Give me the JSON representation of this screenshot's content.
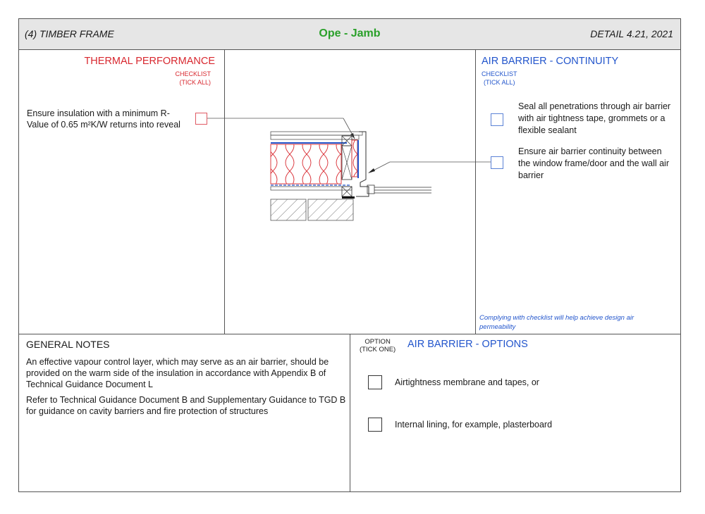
{
  "header": {
    "left": "(4) TIMBER FRAME",
    "center": "Ope - Jamb",
    "right": "DETAIL 4.21,  2021"
  },
  "thermal": {
    "title": "THERMAL PERFORMANCE",
    "checklist": "CHECKLIST",
    "tick": "(TICK ALL)",
    "item": "Ensure insulation with a minimum R-Value of 0.65 m²K/W returns into reveal"
  },
  "air_barrier": {
    "title": "AIR BARRIER - CONTINUITY",
    "checklist": "CHECKLIST",
    "tick": "(TICK ALL)",
    "items": [
      "Seal all penetrations through air barrier with air tightness tape, grommets or a flexible sealant",
      "Ensure air barrier continuity between the window frame/door and the wall air barrier"
    ],
    "note": "Complying with checklist will help achieve design air permeability"
  },
  "general_notes": {
    "title": "GENERAL NOTES",
    "paragraphs": [
      "An effective vapour control layer, which may serve as an air barrier, should be provided on the warm side of the insulation in accordance with Appendix B of Technical Guidance Document L",
      "Refer to Technical Guidance Document B and Supplementary Guidance to TGD B for guidance on cavity barriers and fire protection of structures"
    ]
  },
  "options": {
    "label_option": "OPTION",
    "label_tick": "(TICK ONE)",
    "title": "AIR BARRIER - OPTIONS",
    "items": [
      "Airtightness membrane and tapes, or",
      "Internal lining, for example, plasterboard"
    ]
  },
  "colors": {
    "thermal": "#d8282f",
    "air_barrier": "#2255cc",
    "title_green": "#2aa02a",
    "header_bg": "#e6e6e6"
  }
}
